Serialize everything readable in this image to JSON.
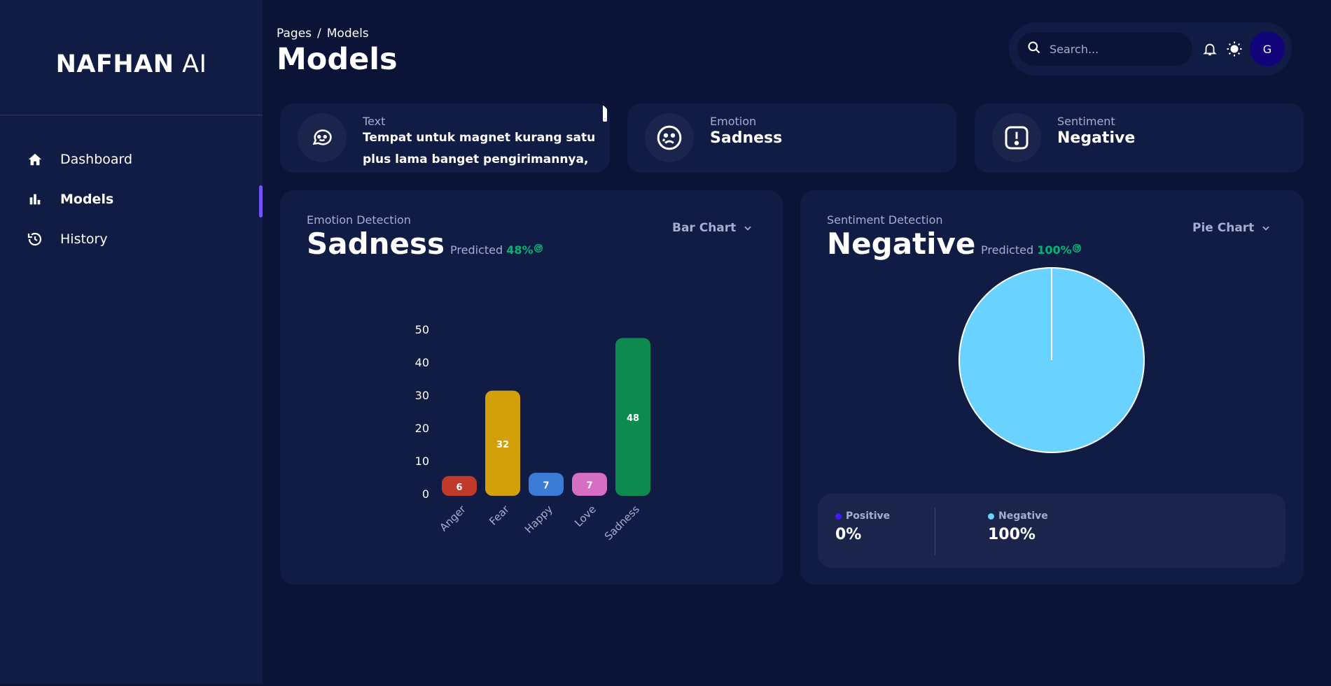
{
  "sidebar": {
    "brand_bold": "NAFHAN",
    "brand_light": "AI",
    "items": [
      {
        "label": "Dashboard",
        "icon": "home-icon"
      },
      {
        "label": "Models",
        "icon": "bar-chart-icon",
        "active": true
      },
      {
        "label": "History",
        "icon": "history-icon"
      }
    ]
  },
  "header": {
    "breadcrumb_root": "Pages",
    "breadcrumb_sep": "/",
    "breadcrumb_current": "Models",
    "title": "Models",
    "search_placeholder": "Search...",
    "avatar_initial": "G"
  },
  "cards": {
    "text": {
      "label": "Text",
      "value": "Tempat untuk magnet kurang satu plus lama banget pengirimannya,",
      "icon": "chat-icon"
    },
    "emotion": {
      "label": "Emotion",
      "value": "Sadness",
      "icon": "sad-face-icon"
    },
    "sentiment": {
      "label": "Sentiment",
      "value": "Negative",
      "icon": "alert-icon"
    }
  },
  "emotion_panel": {
    "label": "Emotion Detection",
    "result": "Sadness",
    "predicted_label": "Predicted",
    "predicted_pct": "48%",
    "chart_select": "Bar Chart"
  },
  "sentiment_panel": {
    "label": "Sentiment Detection",
    "result": "Negative",
    "predicted_label": "Predicted",
    "predicted_pct": "100%",
    "chart_select": "Pie Chart",
    "legend": [
      {
        "name": "Positive",
        "value": "0%",
        "color": "#4318ff"
      },
      {
        "name": "Negative",
        "value": "100%",
        "color": "#6ad2ff"
      }
    ]
  },
  "colors": {
    "bg": "#0b1437",
    "card": "#111c44",
    "accent": "#7551ff",
    "green": "#01b574"
  },
  "chart_data": [
    {
      "type": "bar",
      "categories": [
        "Anger",
        "Fear",
        "Happy",
        "Love",
        "Sadness"
      ],
      "values": [
        6,
        32,
        7,
        7,
        48
      ],
      "colors": [
        "#c0392b",
        "#d4a00a",
        "#3a7bd5",
        "#d66fc4",
        "#0d8a4f"
      ],
      "yticks": [
        0,
        10,
        20,
        30,
        40,
        50
      ],
      "ylim": [
        0,
        50
      ]
    },
    {
      "type": "pie",
      "labels": [
        "Positive",
        "Negative"
      ],
      "values": [
        0,
        100
      ],
      "colors": [
        "#4318ff",
        "#6ad2ff"
      ]
    }
  ]
}
